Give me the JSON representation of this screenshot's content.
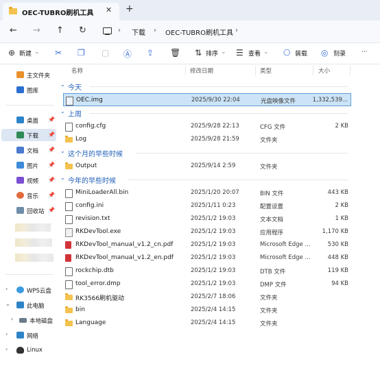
{
  "window": {
    "tab_title": "OEC-TUBRO刷机工具",
    "tab_close": "✕",
    "tab_new": "+"
  },
  "nav": {
    "back": "←",
    "forward": "→",
    "up": "↑",
    "refresh": "↻",
    "breadcrumb": [
      "下载",
      "OEC-TUBRO刷机工具"
    ],
    "sep": "›"
  },
  "toolbar": {
    "new_label": "新建",
    "sort_label": "排序",
    "view_label": "查看",
    "mount_label": "装载",
    "burn_label": "刻录",
    "more_label": "···"
  },
  "sidebar": {
    "items": [
      {
        "label": "主文件夹",
        "icon": "home-icon",
        "color": "#e8912d"
      },
      {
        "label": "图库",
        "icon": "gallery-icon",
        "color": "#2b6fd1"
      },
      {
        "label": "桌面",
        "icon": "desktop-icon",
        "color": "#2e84c9"
      },
      {
        "label": "下载",
        "icon": "download-icon",
        "color": "#2e8b57"
      },
      {
        "label": "文档",
        "icon": "documents-icon",
        "color": "#4a7bd0"
      },
      {
        "label": "图片",
        "icon": "pictures-icon",
        "color": "#3d8bd9"
      },
      {
        "label": "视频",
        "icon": "videos-icon",
        "color": "#7a4fd1"
      },
      {
        "label": "音乐",
        "icon": "music-icon",
        "color": "#e06a3b"
      },
      {
        "label": "回收站",
        "icon": "recycle-bin-icon",
        "color": "#6e8da8"
      }
    ],
    "bottom": [
      {
        "label": "WPS云盘",
        "icon": "cloud-icon",
        "color": "#3c9be0"
      },
      {
        "label": "此电脑",
        "icon": "pc-icon",
        "color": "#2e84c9"
      },
      {
        "label": "本地磁盘",
        "icon": "drive-icon",
        "color": "#6b7c8c"
      },
      {
        "label": "网络",
        "icon": "network-icon",
        "color": "#2e84c9"
      },
      {
        "label": "Linux",
        "icon": "linux-icon",
        "color": "#333333"
      }
    ]
  },
  "columns": {
    "name": "名称",
    "date": "修改日期",
    "type": "类型",
    "size": "大小"
  },
  "groups": [
    {
      "title": "今天",
      "rows": [
        {
          "name": "OEC.img",
          "date": "2025/9/30 22:04",
          "type": "光盘映像文件",
          "size": "1,332,539...",
          "kind": "img",
          "selected": true
        }
      ]
    },
    {
      "title": "上周",
      "rows": [
        {
          "name": "config.cfg",
          "date": "2025/9/28 22:13",
          "type": "CFG 文件",
          "size": "2 KB",
          "kind": "doc"
        },
        {
          "name": "Log",
          "date": "2025/9/28 21:59",
          "type": "文件夹",
          "size": "",
          "kind": "folder"
        }
      ]
    },
    {
      "title": "这个月的早些时候",
      "rows": [
        {
          "name": "Output",
          "date": "2025/9/14 2:59",
          "type": "文件夹",
          "size": "",
          "kind": "folder"
        }
      ]
    },
    {
      "title": "今年的早些时候",
      "rows": [
        {
          "name": "MiniLoaderAll.bin",
          "date": "2025/1/20 20:07",
          "type": "BIN 文件",
          "size": "443 KB",
          "kind": "doc"
        },
        {
          "name": "config.ini",
          "date": "2025/1/11 0:23",
          "type": "配置设置",
          "size": "2 KB",
          "kind": "ini"
        },
        {
          "name": "revision.txt",
          "date": "2025/1/2 19:03",
          "type": "文本文档",
          "size": "1 KB",
          "kind": "doc"
        },
        {
          "name": "RKDevTool.exe",
          "date": "2025/1/2 19:03",
          "type": "应用程序",
          "size": "1,170 KB",
          "kind": "exe"
        },
        {
          "name": "RKDevTool_manual_v1.2_cn.pdf",
          "date": "2025/1/2 19:03",
          "type": "Microsoft Edge ...",
          "size": "530 KB",
          "kind": "pdf"
        },
        {
          "name": "RKDevTool_manual_v1.2_en.pdf",
          "date": "2025/1/2 19:03",
          "type": "Microsoft Edge ...",
          "size": "448 KB",
          "kind": "pdf"
        },
        {
          "name": "rockchip.dtb",
          "date": "2025/1/2 19:03",
          "type": "DTB 文件",
          "size": "119 KB",
          "kind": "doc"
        },
        {
          "name": "tool_error.dmp",
          "date": "2025/1/2 19:03",
          "type": "DMP 文件",
          "size": "94 KB",
          "kind": "doc"
        },
        {
          "name": "RK3566刷机驱动",
          "date": "2025/2/7 18:06",
          "type": "文件夹",
          "size": "",
          "kind": "folder"
        },
        {
          "name": "bin",
          "date": "2025/2/4 14:15",
          "type": "文件夹",
          "size": "",
          "kind": "folder"
        },
        {
          "name": "Language",
          "date": "2025/2/4 14:15",
          "type": "文件夹",
          "size": "",
          "kind": "folder"
        }
      ]
    }
  ]
}
